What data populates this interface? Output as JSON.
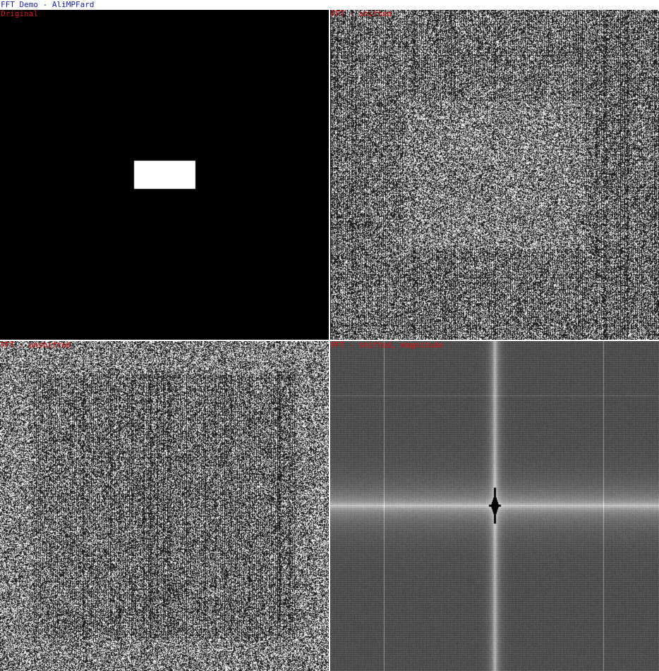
{
  "window": {
    "title": "FFT Demo - AliMPFard"
  },
  "colors": {
    "title_text": "#1a1ab8",
    "label_text": "#e01010",
    "rect_fill": "#ffffff",
    "background": "#000000"
  },
  "panels": [
    {
      "label": "Original",
      "kind": "original"
    },
    {
      "label": "FFT - shifted",
      "kind": "fft-noise-shifted"
    },
    {
      "label": "FFT - unshifted",
      "kind": "fft-noise-unshifted"
    },
    {
      "label": "FFT - shifted, magnitude",
      "kind": "fft-magnitude"
    }
  ]
}
